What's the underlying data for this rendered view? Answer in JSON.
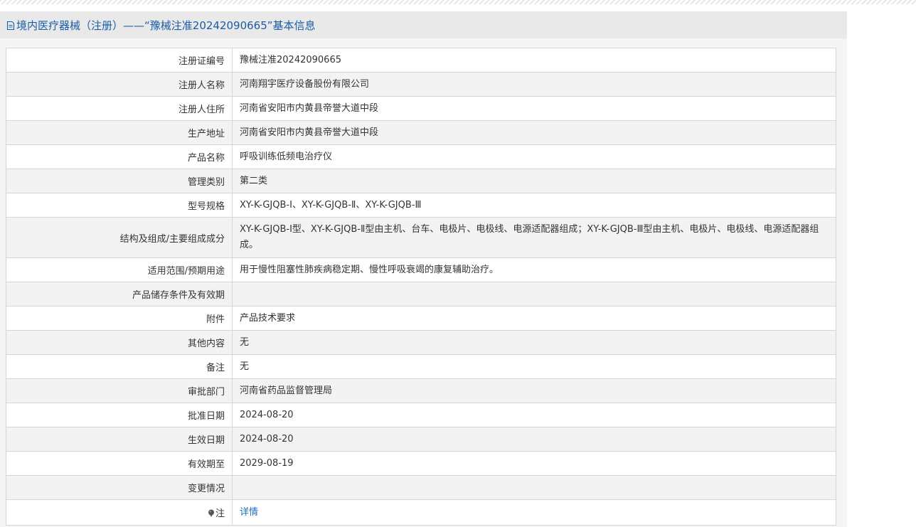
{
  "header": {
    "title": "境内医疗器械（注册）——“豫械注准20242090665”基本信息",
    "icon": "document-icon"
  },
  "rows": [
    {
      "label": "注册证编号",
      "value": "豫械注准20242090665"
    },
    {
      "label": "注册人名称",
      "value": "河南翔宇医疗设备股份有限公司"
    },
    {
      "label": "注册人住所",
      "value": "河南省安阳市内黄县帝誉大道中段"
    },
    {
      "label": "生产地址",
      "value": "河南省安阳市内黄县帝誉大道中段"
    },
    {
      "label": "产品名称",
      "value": "呼吸训练低频电治疗仪"
    },
    {
      "label": "管理类别",
      "value": "第二类"
    },
    {
      "label": "型号规格",
      "value": "XY-K-GJQB-Ⅰ、XY-K-GJQB-Ⅱ、XY-K-GJQB-Ⅲ"
    },
    {
      "label": "结构及组成/主要组成成分",
      "value": "XY-K-GJQB-Ⅰ型、XY-K-GJQB-Ⅱ型由主机、台车、电极片、电极线、电源适配器组成；XY-K-GJQB-Ⅲ型由主机、电极片、电极线、电源适配器组成。"
    },
    {
      "label": "适用范围/预期用途",
      "value": "用于慢性阻塞性肺疾病稳定期、慢性呼吸衰竭的康复辅助治疗。"
    },
    {
      "label": "产品储存条件及有效期",
      "value": ""
    },
    {
      "label": "附件",
      "value": "产品技术要求"
    },
    {
      "label": "其他内容",
      "value": "无"
    },
    {
      "label": "备注",
      "value": "无"
    },
    {
      "label": "审批部门",
      "value": "河南省药品监督管理局"
    },
    {
      "label": "批准日期",
      "value": "2024-08-20"
    },
    {
      "label": "生效日期",
      "value": "2024-08-20"
    },
    {
      "label": "有效期至",
      "value": "2029-08-19"
    },
    {
      "label": "变更情况",
      "value": ""
    }
  ],
  "note": {
    "label": "注",
    "icon": "note-icon",
    "link_label": "详情"
  },
  "colors": {
    "header_text": "#1a5ca8",
    "link": "#1a6fc2",
    "header_bg": "#e9e9e9",
    "border": "#d6d6d6"
  }
}
